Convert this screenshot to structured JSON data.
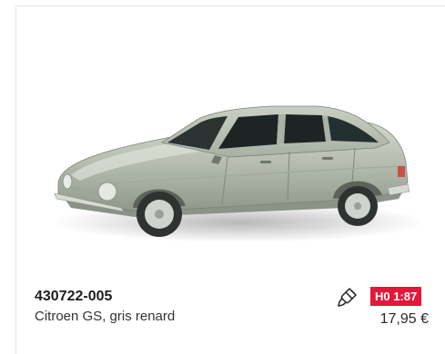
{
  "product": {
    "article_number": "430722-005",
    "name": "Citroen GS, gris renard",
    "price": "17,95 €",
    "scale_badge": "H0 1:87",
    "icon": "paintbrush-icon",
    "image": "car-model-image"
  },
  "colors": {
    "badge_background": "#e3183a",
    "car_body": "#b9bfb3",
    "border": "#e6e6e6"
  }
}
